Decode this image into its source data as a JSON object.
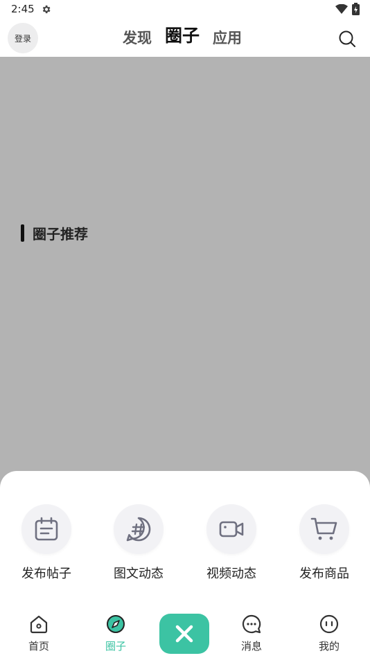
{
  "status_bar": {
    "time": "2:45"
  },
  "header": {
    "login_label": "登录",
    "tabs": [
      {
        "label": "发现",
        "active": false
      },
      {
        "label": "圈子",
        "active": true
      },
      {
        "label": "应用",
        "active": false
      }
    ]
  },
  "main": {
    "section_title": "圈子推荐"
  },
  "sheet": {
    "actions": [
      {
        "label": "发布帖子",
        "icon": "calendar-note-icon"
      },
      {
        "label": "图文动态",
        "icon": "hashtag-icon"
      },
      {
        "label": "视频动态",
        "icon": "video-camera-icon"
      },
      {
        "label": "发布商品",
        "icon": "shopping-cart-icon"
      }
    ]
  },
  "bottom_nav": {
    "items": [
      {
        "label": "首页",
        "icon": "home-icon",
        "active": false
      },
      {
        "label": "圈子",
        "icon": "compass-icon",
        "active": true
      },
      {
        "label": "消息",
        "icon": "chat-icon",
        "active": false
      },
      {
        "label": "我的",
        "icon": "profile-face-icon",
        "active": false
      }
    ],
    "center_button_icon": "close-icon"
  },
  "colors": {
    "accent": "#3cc3a3",
    "overlay": "#b3b3b3"
  }
}
